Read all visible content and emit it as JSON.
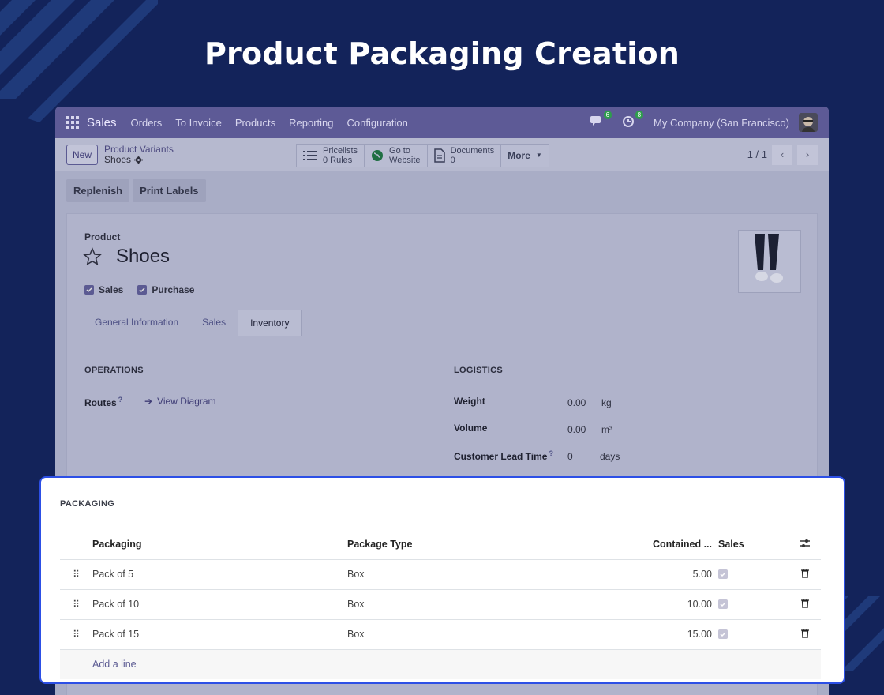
{
  "hero_title": "Product Packaging Creation",
  "topnav": {
    "brand": "Sales",
    "items": [
      "Orders",
      "To Invoice",
      "Products",
      "Reporting",
      "Configuration"
    ],
    "messages_count": "6",
    "activities_count": "8",
    "company": "My Company (San Francisco)"
  },
  "controlbar": {
    "new_label": "New",
    "breadcrumb_parent": "Product Variants",
    "breadcrumb_current": "Shoes",
    "smart_buttons": {
      "pricelists_label": "Pricelists",
      "pricelists_value": "0 Rules",
      "website_label": "Go to",
      "website_value": "Website",
      "documents_label": "Documents",
      "documents_value": "0",
      "more_label": "More"
    },
    "pager": "1 / 1"
  },
  "actions": {
    "replenish": "Replenish",
    "print_labels": "Print Labels"
  },
  "product": {
    "label": "Product",
    "name": "Shoes",
    "sales_label": "Sales",
    "purchase_label": "Purchase"
  },
  "tabs": [
    "General Information",
    "Sales",
    "Inventory"
  ],
  "operations": {
    "title": "OPERATIONS",
    "routes_label": "Routes",
    "help_mark": "?",
    "view_diagram": "View Diagram"
  },
  "logistics": {
    "title": "LOGISTICS",
    "weight_label": "Weight",
    "weight_value": "0.00",
    "weight_unit": "kg",
    "volume_label": "Volume",
    "volume_value": "0.00",
    "volume_unit": "m³",
    "lead_label": "Customer Lead Time",
    "lead_value": "0",
    "lead_unit": "days"
  },
  "packaging": {
    "title": "PACKAGING",
    "columns": {
      "packaging": "Packaging",
      "package_type": "Package Type",
      "contained": "Contained ...",
      "sales": "Sales"
    },
    "rows": [
      {
        "name": "Pack of 5",
        "type": "Box",
        "qty": "5.00"
      },
      {
        "name": "Pack of 10",
        "type": "Box",
        "qty": "10.00"
      },
      {
        "name": "Pack of 15",
        "type": "Box",
        "qty": "15.00"
      }
    ],
    "add_line": "Add a line"
  },
  "colors": {
    "background": "#13235a",
    "highlight_border": "#2c4fe6",
    "navbar": "#5d5a96",
    "accent": "#5b5a92"
  }
}
